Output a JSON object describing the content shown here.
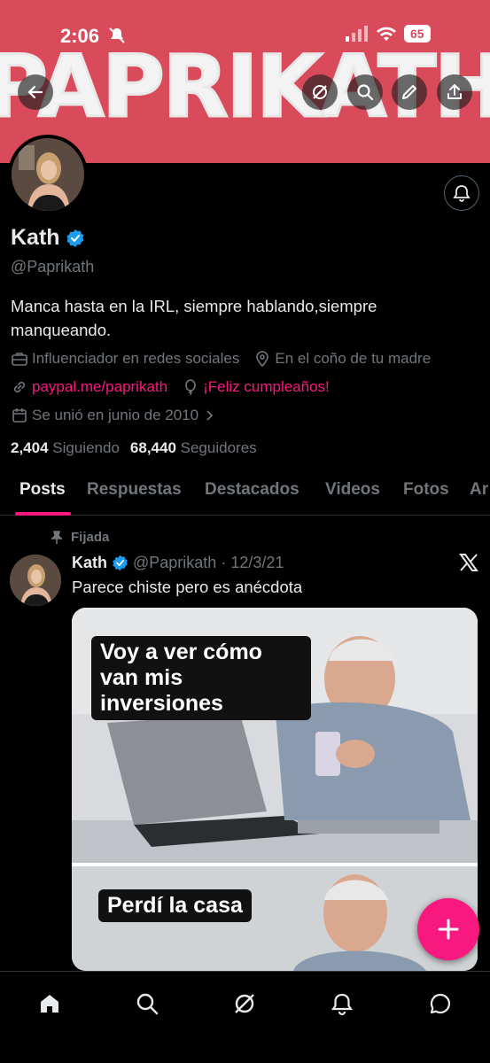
{
  "status_bar": {
    "time": "2:06",
    "battery": "65"
  },
  "banner": {
    "text": "PAPRIKATH"
  },
  "profile": {
    "name": "Kath",
    "handle": "@Paprikath",
    "bio": "Manca hasta en la IRL, siempre hablando,siempre manqueando.",
    "category": "Influenciador en redes sociales",
    "location": "En el coño de tu madre",
    "link": "paypal.me/paprikath",
    "birthday": "¡Feliz cumpleaños!",
    "joined": "Se unió en junio de 2010",
    "following_count": "2,404",
    "following_label": "Siguiendo",
    "followers_count": "68,440",
    "followers_label": "Seguidores"
  },
  "tabs": [
    "Posts",
    "Respuestas",
    "Destacados",
    "Videos",
    "Fotos",
    "Ar"
  ],
  "post": {
    "pinned_label": "Fijada",
    "name": "Kath",
    "handle": "@Paprikath",
    "date": "· 12/3/21",
    "text": "Parece chiste pero es anécdota",
    "meme_top": "Voy a ver cómo van mis inversiones",
    "meme_bottom": "Perdí la casa"
  },
  "colors": {
    "accent": "#f91880",
    "verified": "#1d9bf0",
    "banner": "#d94b5b"
  }
}
